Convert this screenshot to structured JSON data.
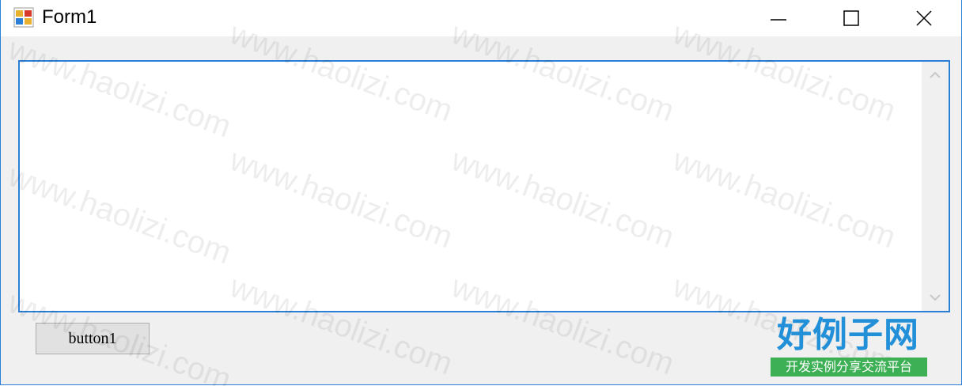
{
  "window": {
    "title": "Form1",
    "controls": {
      "minimize": "minimize-icon",
      "maximize": "maximize-icon",
      "close": "close-icon"
    }
  },
  "textbox": {
    "value": ""
  },
  "button1": {
    "label": "button1"
  },
  "watermark": {
    "text": "www.haolizi.com"
  },
  "logo": {
    "main": "好例子网",
    "sub": "开发实例分享交流平台"
  },
  "colors": {
    "accent": "#2b7fd6",
    "logo_blue": "#2290d8",
    "logo_green": "#3daf54"
  }
}
